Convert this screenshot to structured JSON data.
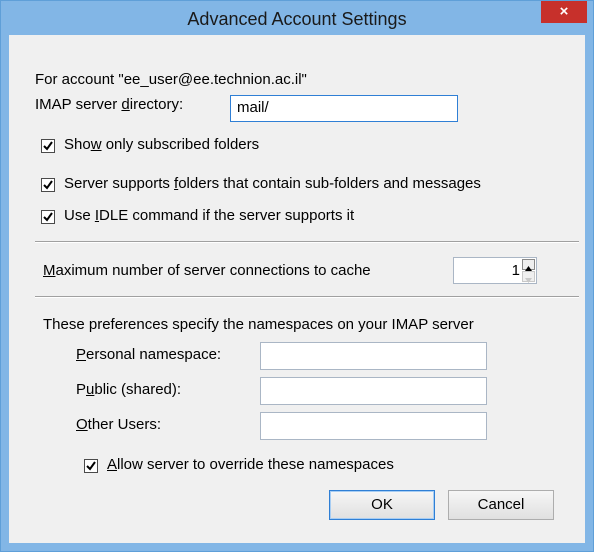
{
  "window": {
    "title": "Advanced Account Settings",
    "close_glyph": "×"
  },
  "account": {
    "label": "For account \"ee_user@ee.technion.ac.il\"",
    "imap_dir_label_pre": "IMAP server ",
    "imap_dir_label_key": "d",
    "imap_dir_label_post": "irectory:",
    "imap_dir_value": "mail/"
  },
  "options": [
    {
      "pre": "Sho",
      "key": "w",
      "post": " only subscribed folders",
      "checked": true
    },
    {
      "pre": "Server supports ",
      "key": "f",
      "post": "olders that contain sub-folders and messages",
      "checked": true
    },
    {
      "pre": "Use ",
      "key": "I",
      "post": "DLE command if the server supports it",
      "checked": true
    }
  ],
  "connections": {
    "pre": "",
    "key": "M",
    "post": "aximum number of server connections to cache",
    "value": "1"
  },
  "namespaces": {
    "intro": "These preferences specify the namespaces on your IMAP server",
    "personal_pre": "",
    "personal_key": "P",
    "personal_post": "ersonal namespace:",
    "public_pre": "P",
    "public_key": "u",
    "public_post": "blic (shared):",
    "other_pre": "",
    "other_key": "O",
    "other_post": "ther Users:",
    "personal_value": "",
    "public_value": "",
    "other_value": "",
    "override_pre": "",
    "override_key": "A",
    "override_post": "llow server to override these namespaces",
    "override_checked": true
  },
  "buttons": {
    "ok": "OK",
    "cancel": "Cancel"
  }
}
